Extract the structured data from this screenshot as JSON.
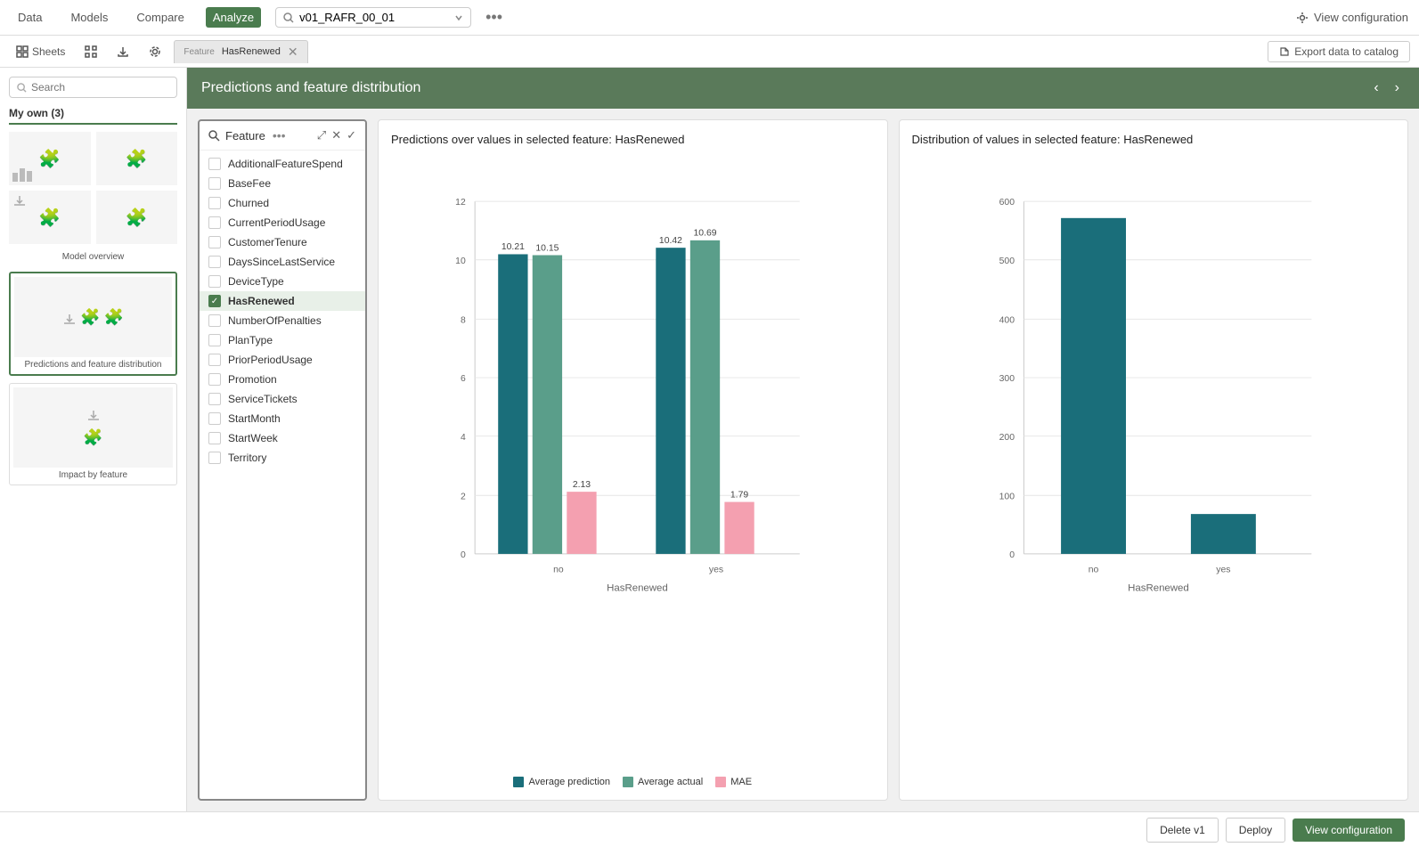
{
  "topnav": {
    "items": [
      {
        "label": "Data",
        "active": false
      },
      {
        "label": "Models",
        "active": false
      },
      {
        "label": "Compare",
        "active": false
      },
      {
        "label": "Analyze",
        "active": true
      }
    ],
    "search_value": "v01_RAFR_00_01",
    "dots": "•••",
    "view_config": "View configuration"
  },
  "toolbar": {
    "sheets_label": "Sheets",
    "tab_feature": "Feature",
    "tab_sub": "HasRenewed",
    "export_label": "Export data to catalog"
  },
  "sidebar": {
    "search_placeholder": "Search",
    "section_title": "My own (3)",
    "sheets": [
      {
        "label": "Model overview",
        "type": "grid"
      },
      {
        "label": "Predictions and feature distribution",
        "type": "single",
        "active": true
      },
      {
        "label": "Impact by feature",
        "type": "single"
      }
    ]
  },
  "content": {
    "title": "Predictions and feature distribution",
    "nav_prev": "‹",
    "nav_next": "›"
  },
  "feature_panel": {
    "title": "Feature",
    "features": [
      {
        "name": "AdditionalFeatureSpend",
        "checked": false
      },
      {
        "name": "BaseFee",
        "checked": false
      },
      {
        "name": "Churned",
        "checked": false
      },
      {
        "name": "CurrentPeriodUsage",
        "checked": false
      },
      {
        "name": "CustomerTenure",
        "checked": false
      },
      {
        "name": "DaysSinceLastService",
        "checked": false
      },
      {
        "name": "DeviceType",
        "checked": false
      },
      {
        "name": "HasRenewed",
        "checked": true
      },
      {
        "name": "NumberOfPenalties",
        "checked": false
      },
      {
        "name": "PlanType",
        "checked": false
      },
      {
        "name": "PriorPeriodUsage",
        "checked": false
      },
      {
        "name": "Promotion",
        "checked": false
      },
      {
        "name": "ServiceTickets",
        "checked": false
      },
      {
        "name": "StartMonth",
        "checked": false
      },
      {
        "name": "StartWeek",
        "checked": false
      },
      {
        "name": "Territory",
        "checked": false
      }
    ]
  },
  "chart1": {
    "title": "Predictions over values in selected feature: HasRenewed",
    "x_label": "HasRenewed",
    "y_max": 12,
    "y_min": 0,
    "groups": [
      "no",
      "yes"
    ],
    "series": {
      "avg_prediction": {
        "label": "Average prediction",
        "color": "#1a6e7a"
      },
      "avg_actual": {
        "label": "Average actual",
        "color": "#5a9e8a"
      },
      "mae": {
        "label": "MAE",
        "color": "#f4a0b0"
      }
    },
    "bars": [
      {
        "group": "no",
        "avg_pred": 10.21,
        "avg_actual": 10.15,
        "mae": 2.13
      },
      {
        "group": "yes",
        "avg_pred": 10.42,
        "avg_actual": 10.69,
        "mae": 1.79
      }
    ]
  },
  "chart2": {
    "title": "Distribution of values in selected feature: HasRenewed",
    "x_label": "HasRenewed",
    "y_max": 600,
    "y_min": 0,
    "groups": [
      "no",
      "yes"
    ],
    "bars": [
      {
        "group": "no",
        "value": 572
      },
      {
        "group": "yes",
        "value": 68
      }
    ]
  },
  "bottom_bar": {
    "delete_label": "Delete v1",
    "deploy_label": "Deploy",
    "view_config_label": "View configuration"
  }
}
